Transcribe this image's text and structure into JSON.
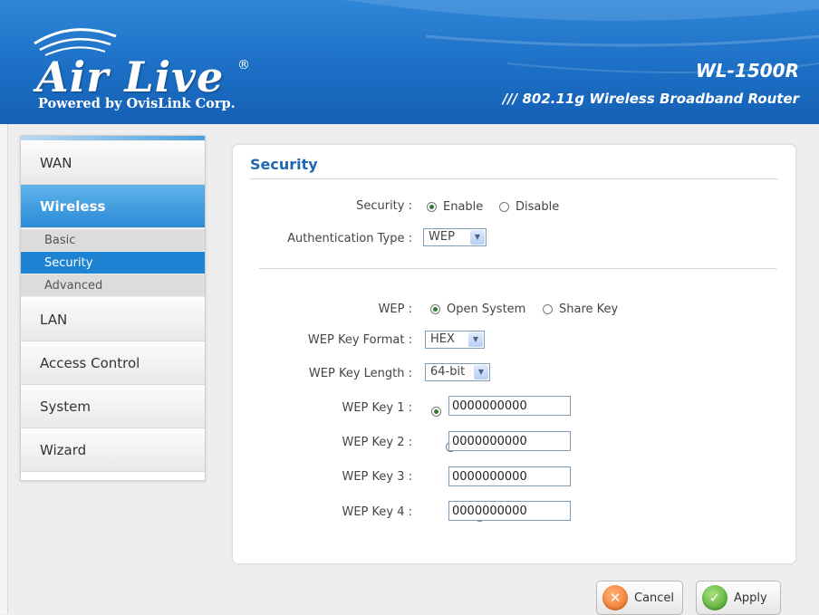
{
  "header": {
    "brand_logo": "Air Live",
    "brand_tagline": "Powered by OvisLink Corp.",
    "model": "WL-1500R",
    "model_description": "/// 802.11g Wireless Broadband Router"
  },
  "sidebar": {
    "items": [
      {
        "label": "WAN"
      },
      {
        "label": "Wireless"
      },
      {
        "label": "LAN"
      },
      {
        "label": "Access Control"
      },
      {
        "label": "System"
      },
      {
        "label": "Wizard"
      }
    ],
    "subitems": [
      {
        "label": "Basic"
      },
      {
        "label": "Security"
      },
      {
        "label": "Advanced"
      }
    ]
  },
  "panel": {
    "title": "Security",
    "security_label": "Security :",
    "security_options": [
      "Enable",
      "Disable"
    ],
    "auth_label": "Authentication Type :",
    "auth_value": "WEP",
    "wep_label": "WEP :",
    "wep_options": [
      "Open System",
      "Share Key"
    ],
    "key_format_label": "WEP Key Format :",
    "key_format_value": "HEX",
    "key_length_label": "WEP Key Length :",
    "key_length_value": "64-bit",
    "keys": [
      {
        "label": "WEP Key 1 :",
        "value": "0000000000"
      },
      {
        "label": "WEP Key 2 :",
        "value": "0000000000"
      },
      {
        "label": "WEP Key 3 :",
        "value": "0000000000"
      },
      {
        "label": "WEP Key 4 :",
        "value": "0000000000"
      }
    ]
  },
  "buttons": {
    "cancel": "Cancel",
    "apply": "Apply"
  },
  "icons": {
    "cancel": "x-icon",
    "apply": "check-icon",
    "dropdown": "chevron-down-icon"
  },
  "colors": {
    "header_blue": "#1c6fc5",
    "accent_blue": "#2a8bd6",
    "title_blue": "#1f66b3"
  }
}
